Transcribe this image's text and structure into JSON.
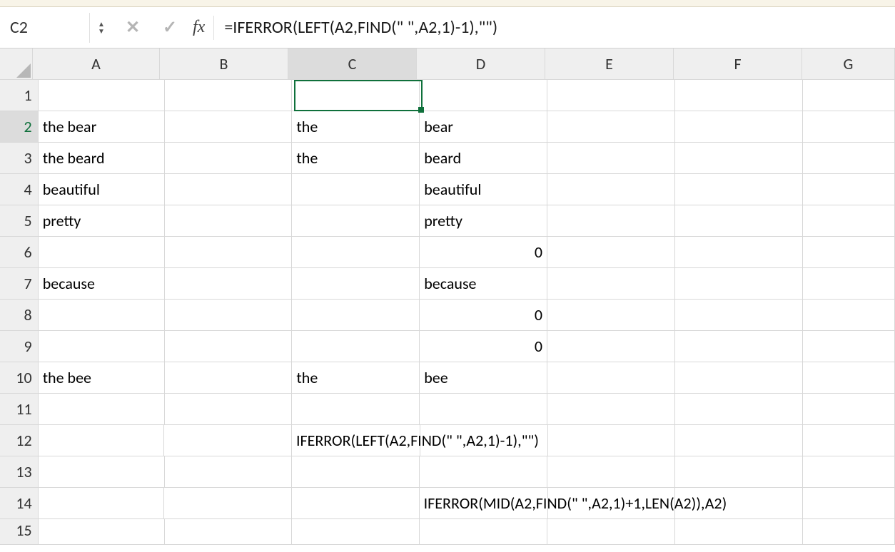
{
  "formula_bar": {
    "active_cell": "C2",
    "fx_label": "fx",
    "formula": "=IFERROR(LEFT(A2,FIND(\" \",A2,1)-1),\"\")"
  },
  "columns": [
    "A",
    "B",
    "C",
    "D",
    "E",
    "F",
    "G"
  ],
  "rows": [
    "1",
    "2",
    "3",
    "4",
    "5",
    "6",
    "7",
    "8",
    "9",
    "10",
    "11",
    "12",
    "13",
    "14",
    "15"
  ],
  "selected_col_index": 2,
  "selected_row_index": 1,
  "cells": {
    "A2": "the bear",
    "A3": "the beard",
    "A4": "beautiful",
    "A5": "pretty",
    "A7": "because",
    "A10": "the bee",
    "C2": "the",
    "C3": "the",
    "C10": "the",
    "D2": "bear",
    "D3": "beard",
    "D4": "beautiful",
    "D5": "pretty",
    "D6": "0",
    "D7": "because",
    "D8": "0",
    "D9": "0",
    "D10": "bee",
    "C12_overflow": "IFERROR(LEFT(A2,FIND(\" \",A2,1)-1),\"\")",
    "D14_overflow": "IFERROR(MID(A2,FIND(\" \",A2,1)+1,LEN(A2)),A2)"
  },
  "numeric_cells": [
    "D6",
    "D8",
    "D9"
  ]
}
